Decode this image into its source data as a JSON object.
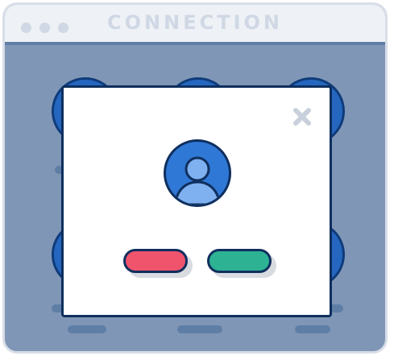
{
  "window": {
    "title": "CONNECTION"
  },
  "modal": {
    "decline_label": "",
    "accept_label": "",
    "close_icon": "close-icon",
    "avatar_icon": "user-avatar-icon"
  },
  "colors": {
    "background": "#7f96b6",
    "titlebar": "#eef1f5",
    "accent_blue": "#2f78d6",
    "decline_red": "#f0546d",
    "accept_green": "#2db394",
    "outline": "#0f2f5e"
  }
}
